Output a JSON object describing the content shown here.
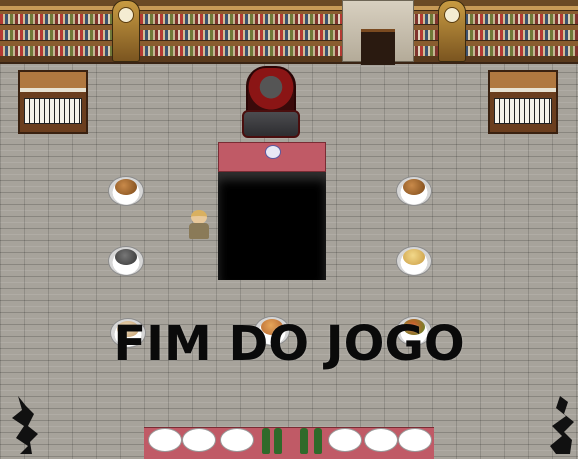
{
  "overlay": {
    "game_over_text": "FIM DO JOGO"
  },
  "colors": {
    "floor": "#a7a39b",
    "carpet": "#c05a66",
    "pit": "#000000",
    "text": "#0a0a0a"
  },
  "scene": {
    "plates": [
      {
        "name": "roast-plate-left",
        "food": "roast"
      },
      {
        "name": "stew-plate-left",
        "food": "stew"
      },
      {
        "name": "roast-plate-right",
        "food": "roast"
      },
      {
        "name": "bread-plate-right",
        "food": "bread"
      },
      {
        "name": "soup-plate-bottom-left",
        "food": "soup"
      },
      {
        "name": "pie-plate-bottom-mid",
        "food": "pie"
      },
      {
        "name": "salad-plate-bottom-right",
        "food": "salad"
      }
    ]
  }
}
